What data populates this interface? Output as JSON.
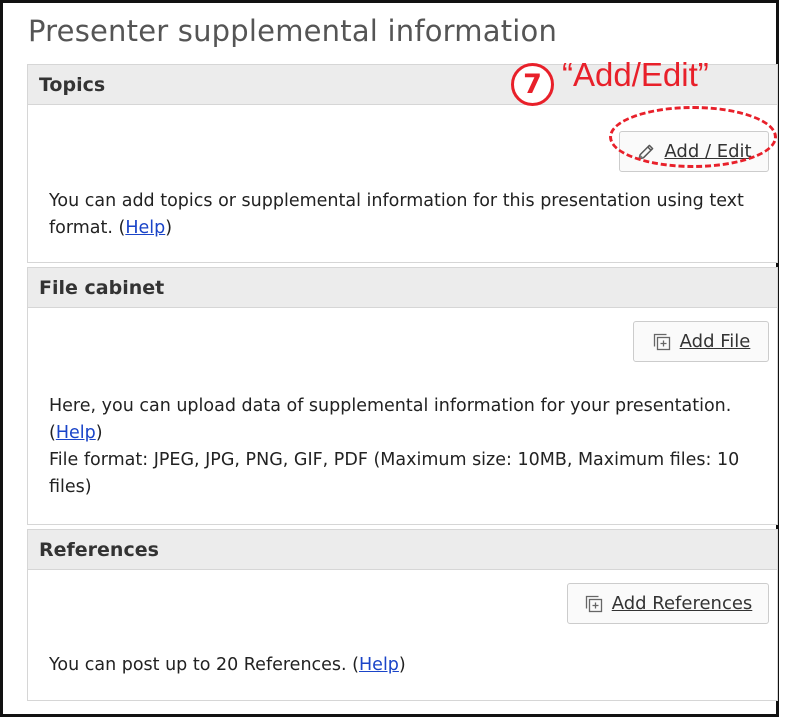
{
  "page": {
    "title": "Presenter supplemental information"
  },
  "topics": {
    "heading": "Topics",
    "button_label": "Add / Edit",
    "desc_text": "You can add topics or supplemental information for this presentation using text format. (",
    "help_label": "Help",
    "desc_close": ")"
  },
  "file_cabinet": {
    "heading": "File cabinet",
    "button_label": "Add File",
    "desc_text": "Here, you can upload data of supplemental information for your presentation. (",
    "help_label": "Help",
    "desc_close": ")",
    "format_text": "File format: JPEG, JPG, PNG, GIF, PDF (Maximum size: 10MB, Maximum files: 10 files)"
  },
  "references": {
    "heading": "References",
    "button_label": "Add References",
    "desc_text": "You can post up to 20 References. (",
    "help_label": "Help",
    "desc_close": ")"
  },
  "annotation": {
    "number": "7",
    "label": "“Add/Edit”",
    "color": "#e8202a"
  },
  "icons": {
    "topics_button": "pencil-icon",
    "file_button": "add-file-icon",
    "references_button": "add-file-icon"
  },
  "colors": {
    "link": "#1a44c8",
    "header_bg": "#ececec",
    "border": "#d6d6d6"
  }
}
